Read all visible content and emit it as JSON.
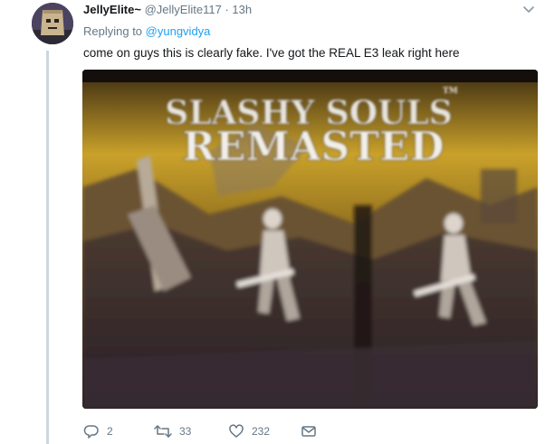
{
  "tweet": {
    "avatar_icon": "paper-bag-mask-avatar",
    "display_name": "JellyElite~",
    "handle": "@JellyElite117",
    "separator": "·",
    "time": "13h",
    "replying_prefix": "Replying to",
    "replying_to": "@yungvidya",
    "text": "come on guys this is clearly fake. I've got the REAL E3 leak right here",
    "media": {
      "title_line1": "SLASHY SOULS",
      "title_line2": "REMASTED",
      "tm_mark": "TM"
    },
    "actions": {
      "reply_icon": "reply-icon",
      "reply_count": "2",
      "retweet_icon": "retweet-icon",
      "retweet_count": "33",
      "like_icon": "heart-icon",
      "like_count": "232",
      "dm_icon": "envelope-icon"
    }
  },
  "colors": {
    "text_primary": "#14171a",
    "text_secondary": "#657786",
    "link": "#1da1f2",
    "thread_line": "#ccd6dd"
  }
}
